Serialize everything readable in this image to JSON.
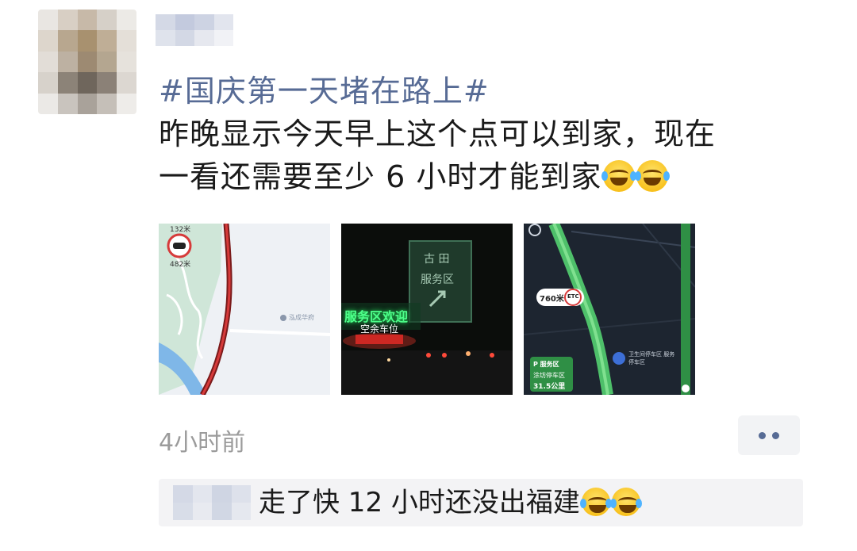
{
  "post": {
    "hashtag": "#国庆第一天堵在路上#",
    "line1": "昨晚显示今天早上这个点可以到家，现在",
    "line2": "一看还需要至少 6 小时才能到家",
    "emojis": [
      "face-with-tears-of-joy-icon",
      "face-with-tears-of-joy-icon"
    ]
  },
  "photos": {
    "photo1": {
      "speed_top": "132米",
      "speed_bottom": "482米",
      "poi": "泓成华府"
    },
    "photo2": {
      "sign_line1": "古 田",
      "sign_line2": "服务区",
      "neon": "服务区欢迎",
      "spaces": "空余车位"
    },
    "photo3": {
      "distance": "760米",
      "etc": "ETC",
      "panel_title": "P 服务区",
      "panel_sub": "涂坊停车区",
      "panel_km": "31.5公里",
      "side_label": "卫生间停车区 服务停车区"
    }
  },
  "meta": {
    "time_ago": "4小时前"
  },
  "comment": {
    "text": "走了快 12 小时还没出福建",
    "emojis": [
      "loudly-crying-face-icon",
      "loudly-crying-face-icon"
    ]
  },
  "colors": {
    "link": "#576b95",
    "text": "#1a1a1a",
    "muted": "#9b9b9b",
    "comment_bg": "#f3f3f5"
  }
}
